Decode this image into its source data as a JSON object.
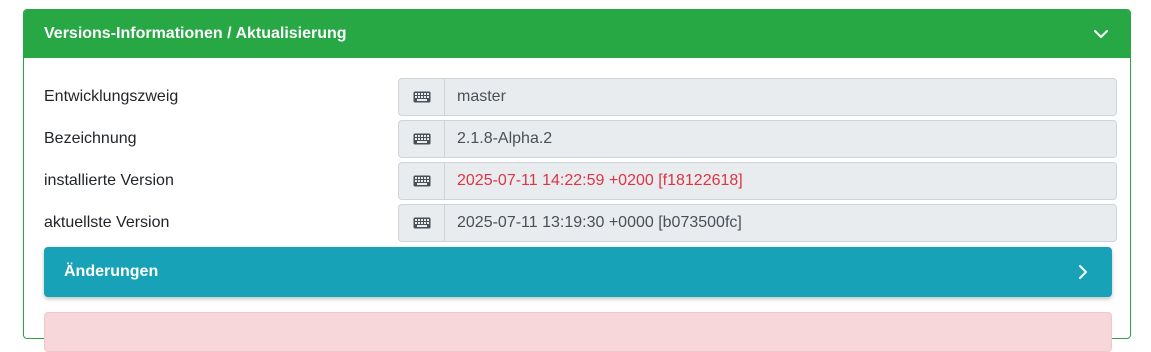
{
  "card": {
    "title": "Versions-Informationen / Aktualisierung",
    "header_color": "#28a745",
    "toggle_icon": "chevron-down-icon"
  },
  "rows": [
    {
      "label": "Entwicklungszweig",
      "value": "master",
      "icon": "keyboard-icon",
      "value_color": "#495057"
    },
    {
      "label": "Bezeichnung",
      "value": "2.1.8-Alpha.2",
      "icon": "keyboard-icon",
      "value_color": "#495057"
    },
    {
      "label": "installierte Version",
      "value": "2025-07-11 14:22:59 +0200 [f18122618]",
      "icon": "keyboard-icon",
      "value_color": "#dc3545"
    },
    {
      "label": "aktuellste Version",
      "value": "2025-07-11 13:19:30 +0000 [b073500fc]",
      "icon": "keyboard-icon",
      "value_color": "#495057"
    }
  ],
  "changes": {
    "title": "Änderungen",
    "color": "#17a2b8",
    "icon": "chevron-right-icon"
  }
}
